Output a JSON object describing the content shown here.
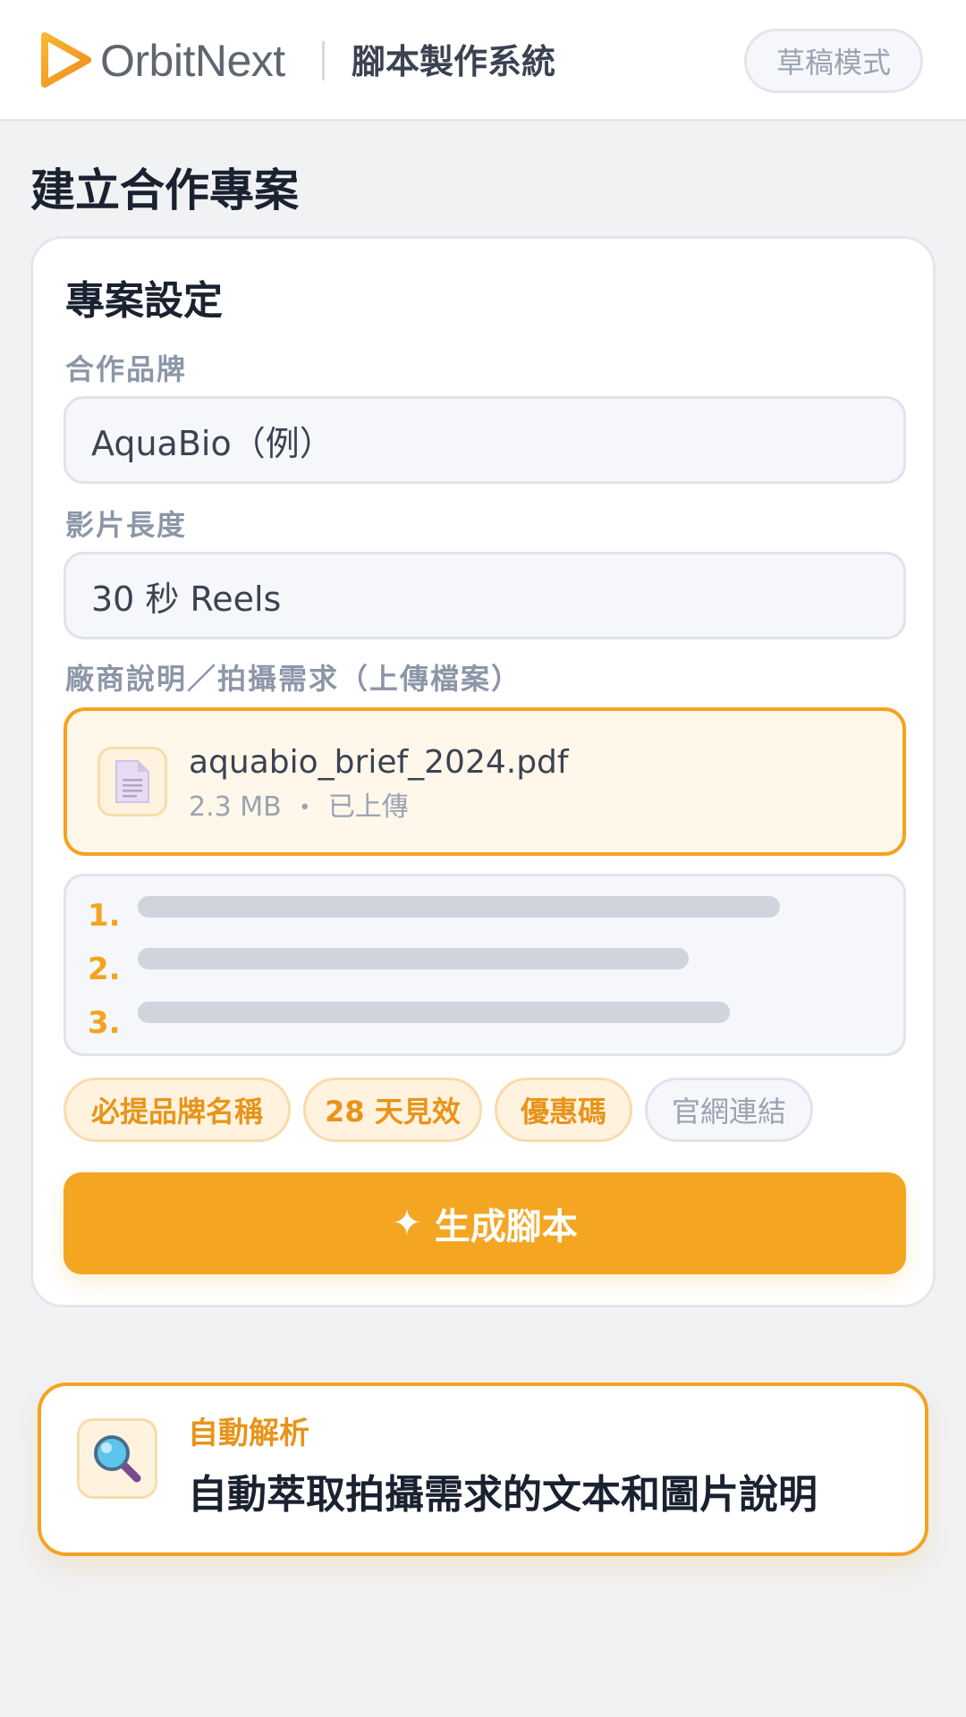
{
  "header": {
    "brand": "OrbitNext",
    "system_title": "腳本製作系統",
    "mode_label": "草稿模式"
  },
  "page": {
    "title": "建立合作專案"
  },
  "project_settings": {
    "section_title": "專案設定",
    "brand_field": {
      "label": "合作品牌",
      "value": "AquaBio（例）"
    },
    "length_field": {
      "label": "影片長度",
      "value": "30 秒 Reels"
    },
    "brief_field": {
      "label": "廠商說明／拍攝需求（上傳檔案）"
    },
    "uploaded_file": {
      "name": "aquabio_brief_2024.pdf",
      "size": "2.3 MB",
      "separator": "•",
      "status": "已上傳",
      "icon": "document-icon"
    },
    "requirements_list": {
      "numbers": [
        "1.",
        "2.",
        "3."
      ],
      "bar_fill": [
        0.78,
        0.67,
        0.72
      ]
    },
    "tags": [
      {
        "label": "必提品牌名稱",
        "selected": true
      },
      {
        "label": "28 天見效",
        "selected": true
      },
      {
        "label": "優惠碼",
        "selected": true
      },
      {
        "label": "官網連結",
        "selected": false
      }
    ],
    "generate_button": {
      "icon": "✦",
      "label": "生成腳本"
    }
  },
  "feature": {
    "icon": "magnifier-icon",
    "kicker": "自動解析",
    "text": "自動萃取拍攝需求的文本和圖片說明"
  },
  "colors": {
    "accent": "#f4a623",
    "accent_text": "#e8941a",
    "background": "#f1f2f4"
  }
}
